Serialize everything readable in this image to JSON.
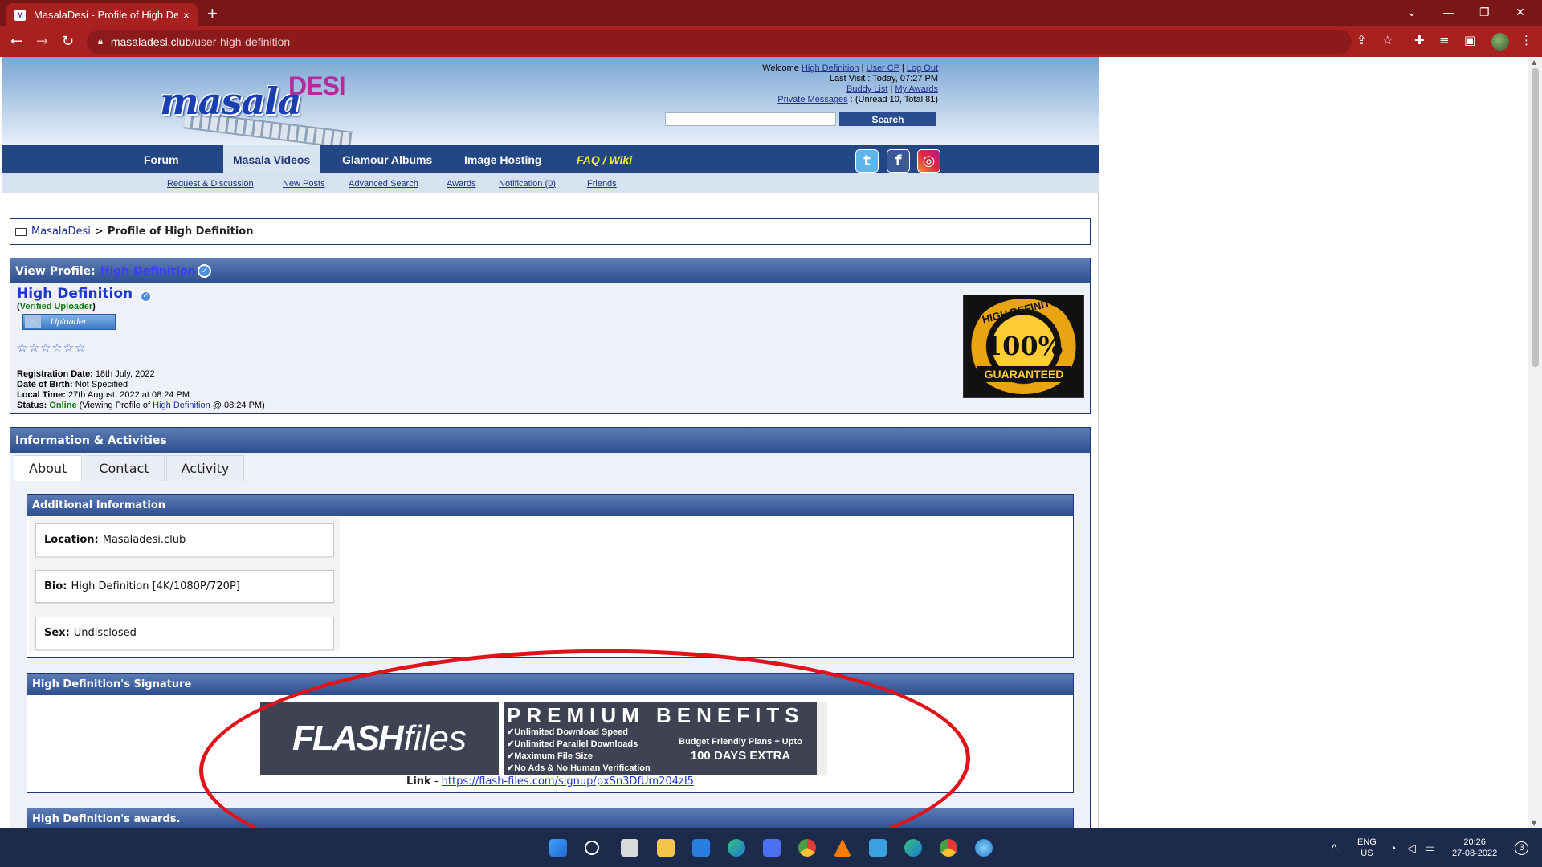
{
  "browser": {
    "tab_title": "MasalaDesi - Profile of High Definition",
    "tab_close": "×",
    "new_tab": "+",
    "url_host": "masaladesi.club",
    "url_path": "/user-high-definition",
    "win_min": "—",
    "win_restore": "❐",
    "win_close": "✕",
    "tab_search": "⌄"
  },
  "site": {
    "logo_masala": "masala",
    "logo_desi": "DESI",
    "welcome_label": "Welcome",
    "welcome_user": "High Definition",
    "user_cp": "User CP",
    "log_out": "Log Out",
    "last_visit": "Last Visit : Today, 07:27 PM",
    "buddy_list": "Buddy List",
    "my_awards": "My Awards",
    "private_messages": "Private Messages",
    "pm_counts": ": (Unread 10, Total 81)",
    "search_button": "Search",
    "nav": [
      "Forum",
      "Masala Videos",
      "Glamour Albums",
      "Image Hosting",
      "FAQ / Wiki"
    ],
    "subnav": [
      "Request & Discussion",
      "New Posts",
      "Advanced Search",
      "Awards",
      "Notification (0)",
      "Friends"
    ],
    "social": {
      "twitter": "t",
      "facebook": "f",
      "instagram": "◎"
    }
  },
  "breadcrumb": {
    "home": "MasalaDesi",
    "separator": ">",
    "current": "Profile of High Definition"
  },
  "profile": {
    "view_label": "View Profile:",
    "username": "High Definition",
    "verified_text": "Verified Uploader",
    "rank_label": "Uploader",
    "stars": "☆☆☆☆☆☆",
    "registration_label": "Registration Date:",
    "registration": "18th July, 2022",
    "dob_label": "Date of Birth:",
    "dob": "Not Specified",
    "localtime_label": "Local Time:",
    "localtime": "27th August, 2022 at 08:24 PM",
    "status_label": "Status:",
    "status": "Online",
    "status_viewing_pre": "(Viewing Profile of",
    "status_viewing_user": "High Definition",
    "status_viewing_post": "@ 08:24 PM)",
    "badge_top": "HIGH DEFINITON",
    "badge_big": "100%",
    "badge_bottom": "GUARANTEED"
  },
  "info": {
    "title": "Information & Activities",
    "tabs": [
      "About",
      "Contact",
      "Activity"
    ],
    "additional_title": "Additional Information",
    "fields": [
      {
        "label": "Location:",
        "value": "Masaladesi.club"
      },
      {
        "label": "Bio:",
        "value": "High Definition [4K/1080P/720P]"
      },
      {
        "label": "Sex:",
        "value": "Undisclosed"
      }
    ],
    "signature_title": "High Definition's Signature",
    "flash_bold": "FLASH",
    "flash_light": "files",
    "premium_title": "PREMIUM BENEFITS",
    "premium_items": [
      "✔Unlimited Download Speed",
      "✔Unlimited Parallel Downloads",
      "✔Maximum File Size",
      "✔No Ads & No Human Verification"
    ],
    "premium_right_small": "Budget Friendly Plans + Upto",
    "premium_right_big": "100 DAYS EXTRA",
    "link_label": "Link",
    "link_sep": "-",
    "link_url": "https://flash-files.com/signup/pxSn3DfUm204zI5",
    "awards_title": "High Definition's awards."
  },
  "taskbar": {
    "lang_top": "ENG",
    "lang_bottom": "US",
    "time": "20:26",
    "date": "27-08-2022",
    "notif": "3"
  },
  "colors": {
    "chrome_red": "#a92020",
    "nav_blue": "#234684",
    "annotation_red": "#e0121a"
  }
}
